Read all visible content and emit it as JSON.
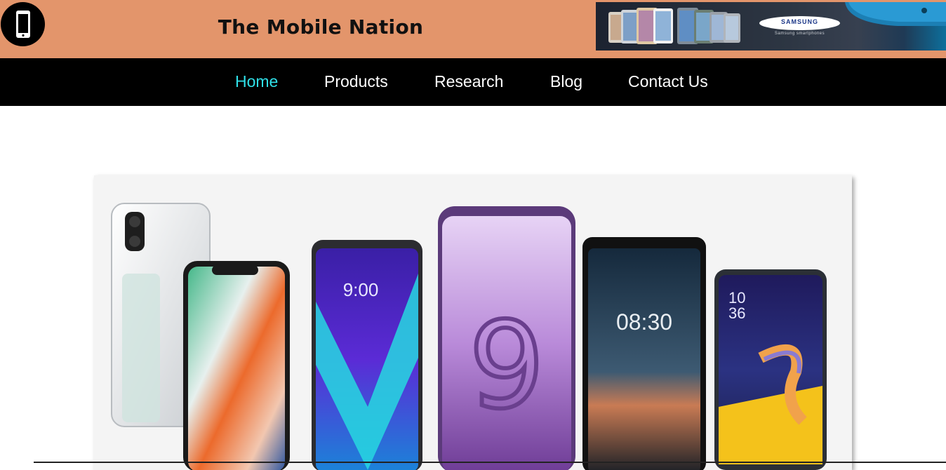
{
  "header": {
    "site_title": "The Mobile Nation",
    "logo_icon": "phone-icon",
    "banner": {
      "brand": "SAMSUNG",
      "tagline": "Samsung smartphones"
    }
  },
  "nav": {
    "items": [
      {
        "label": "Home",
        "active": true
      },
      {
        "label": "Products",
        "active": false
      },
      {
        "label": "Research",
        "active": false
      },
      {
        "label": "Blog",
        "active": false
      },
      {
        "label": "Contact Us",
        "active": false
      }
    ]
  },
  "hero": {
    "phones": [
      {
        "screen_text": ""
      },
      {
        "screen_text": ""
      },
      {
        "screen_text": "9:00"
      },
      {
        "screen_text": "9"
      },
      {
        "screen_text": "08:30"
      },
      {
        "screen_text": "10 36"
      }
    ]
  },
  "colors": {
    "header_bg": "#e3956b",
    "nav_bg": "#000000",
    "nav_active": "#2fe0e8",
    "nav_text": "#ffffff"
  }
}
